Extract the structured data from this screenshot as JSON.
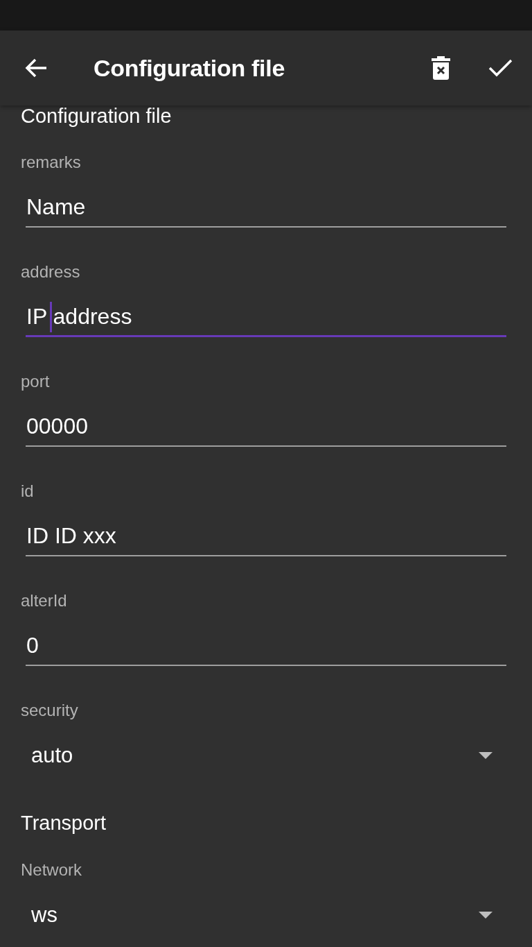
{
  "app_bar": {
    "title": "Configuration file"
  },
  "sections": [
    {
      "title": "Configuration file",
      "fields": [
        {
          "kind": "text",
          "label": "remarks",
          "value": "Name",
          "focused": false
        },
        {
          "kind": "text",
          "label": "address",
          "value": "IP address",
          "focused": true
        },
        {
          "kind": "text",
          "label": "port",
          "value": "00000",
          "focused": false
        },
        {
          "kind": "text",
          "label": "id",
          "value": "ID ID xxx",
          "focused": false
        },
        {
          "kind": "text",
          "label": "alterId",
          "value": "0",
          "focused": false
        },
        {
          "kind": "dropdown",
          "label": "security",
          "value": "auto"
        }
      ]
    },
    {
      "title": "Transport",
      "fields": [
        {
          "kind": "dropdown",
          "label": "Network",
          "value": "ws"
        }
      ]
    }
  ]
}
